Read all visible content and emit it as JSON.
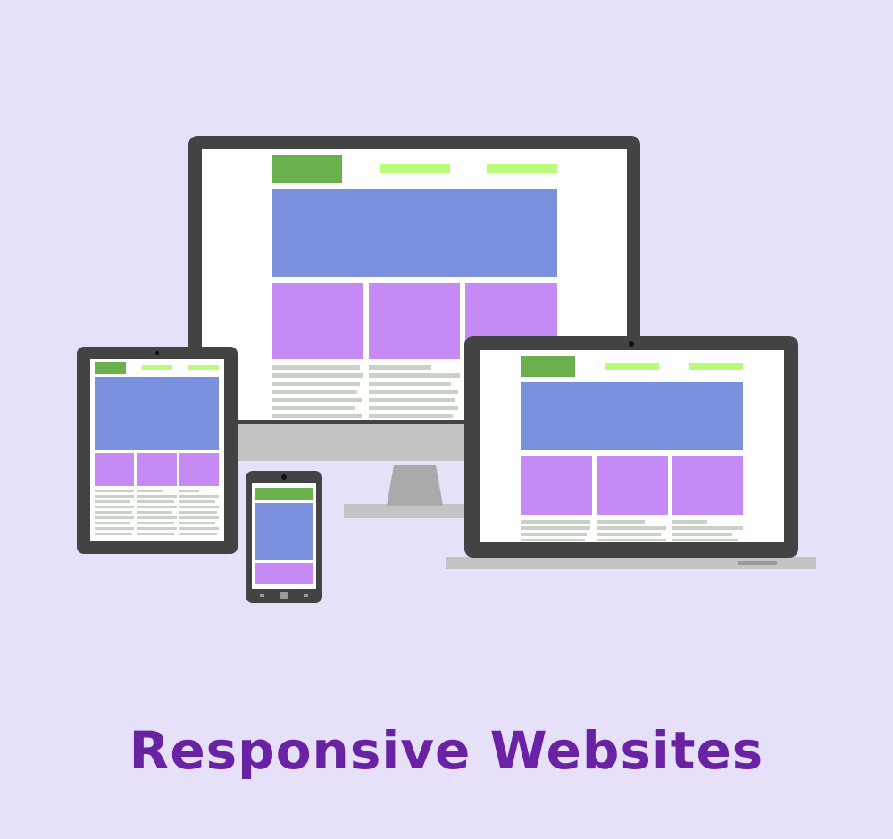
{
  "caption": {
    "text": "Responsive Websites"
  },
  "illustration": {
    "devices": [
      "desktop-monitor",
      "laptop",
      "tablet",
      "smartphone"
    ],
    "colors": {
      "background": "#e6e0f8",
      "frame": "#434343",
      "screen": "#ffffff",
      "logo_block": "#6ab04c",
      "nav_bar": "#b8fc7a",
      "hero_block": "#7b91dd",
      "tile_block": "#c68af5",
      "text_line": "#c7d3c4",
      "stand": "#c4c4c4",
      "caption_text": "#6a22a4"
    }
  }
}
